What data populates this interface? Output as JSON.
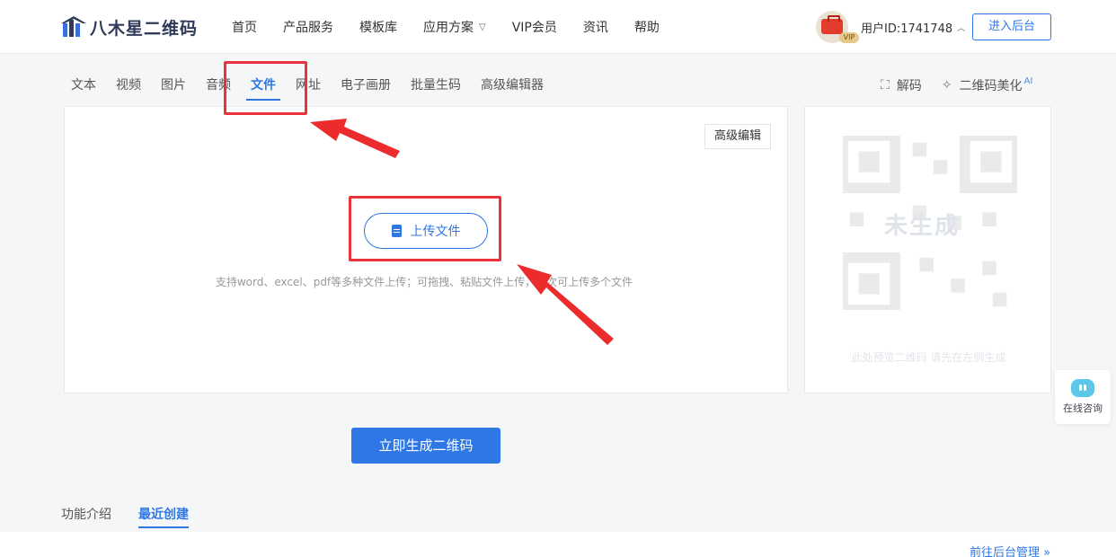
{
  "header": {
    "logo_text": "八木星二维码",
    "nav": [
      {
        "label": "首页"
      },
      {
        "label": "产品服务"
      },
      {
        "label": "模板库"
      },
      {
        "label": "应用方案"
      },
      {
        "label": "VIP会员"
      },
      {
        "label": "资讯"
      },
      {
        "label": "帮助"
      }
    ],
    "vip_badge": "VIP",
    "user_id": "用户ID:1741748",
    "backend_button": "进入后台"
  },
  "type_tabs": [
    {
      "label": "文本"
    },
    {
      "label": "视频"
    },
    {
      "label": "图片"
    },
    {
      "label": "音频"
    },
    {
      "label": "文件",
      "active": true
    },
    {
      "label": "网址"
    },
    {
      "label": "电子画册"
    },
    {
      "label": "批量生码"
    },
    {
      "label": "高级编辑器"
    }
  ],
  "tools": {
    "decode": "解码",
    "beautify": "二维码美化",
    "ai_tag": "AI"
  },
  "editor": {
    "advanced_edit": "高级编辑",
    "upload_button": "上传文件",
    "hint": "支持word、excel、pdf等多种文件上传；可拖拽、粘贴文件上传，一次可上传多个文件"
  },
  "preview": {
    "placeholder_label": "未生成",
    "hint": "此处预览二维码 请先在左侧生成"
  },
  "consult": {
    "label": "在线咨询"
  },
  "generate_button": "立即生成二维码",
  "bottom_tabs": [
    {
      "label": "功能介绍"
    },
    {
      "label": "最近创建",
      "active": true
    }
  ],
  "manage_link": "前往后台管理 »",
  "colors": {
    "accent": "#2e77e5",
    "highlight": "#e8333b"
  }
}
